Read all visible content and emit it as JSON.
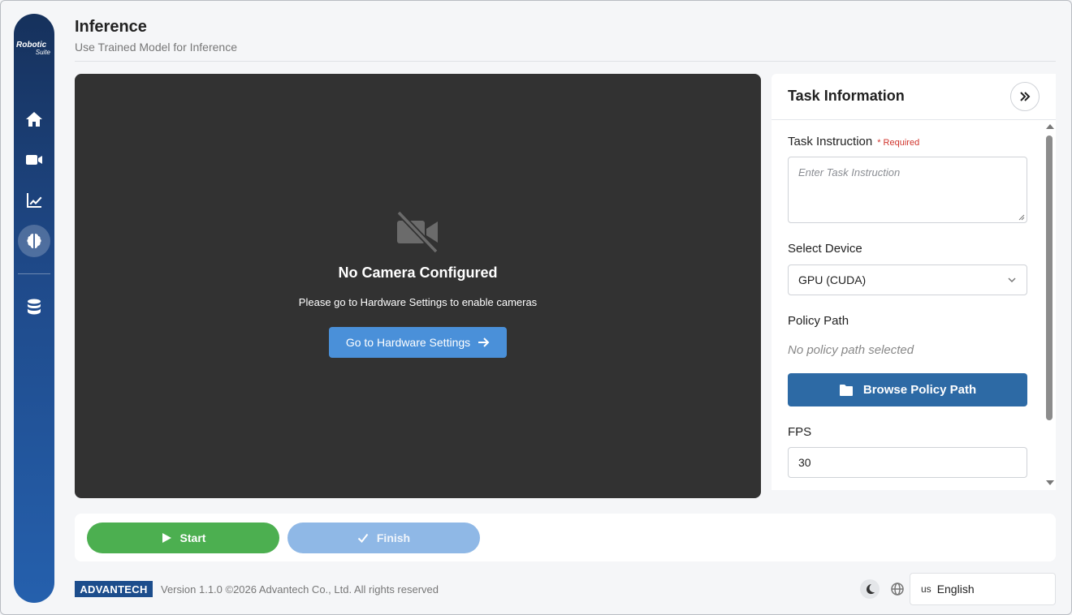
{
  "sidebar": {
    "logo_line1": "Robotic",
    "logo_line2": "Suite",
    "items": [
      {
        "icon": "home-icon"
      },
      {
        "icon": "video-camera-icon"
      },
      {
        "icon": "chart-line-icon"
      },
      {
        "icon": "brain-icon",
        "active": true
      },
      {
        "icon": "database-icon"
      }
    ]
  },
  "header": {
    "title": "Inference",
    "subtitle": "Use Trained Model for Inference"
  },
  "camera": {
    "title": "No Camera Configured",
    "message": "Please go to Hardware Settings to enable cameras",
    "button_label": "Go to Hardware Settings"
  },
  "task_panel": {
    "title": "Task Information",
    "instruction_label": "Task Instruction",
    "required_label": "* Required",
    "instruction_placeholder": "Enter Task Instruction",
    "device_label": "Select Device",
    "device_value": "GPU (CUDA)",
    "policy_label": "Policy Path",
    "policy_value": "No policy path selected",
    "browse_label": "Browse Policy Path",
    "fps_label": "FPS",
    "fps_value": "30"
  },
  "actions": {
    "start_label": "Start",
    "finish_label": "Finish"
  },
  "footer": {
    "brand": "ADVANTECH",
    "version": "Version 1.1.0 ©2026 Advantech Co., Ltd. All rights reserved",
    "language_flag": "us",
    "language": "English"
  },
  "colors": {
    "sidebar": "#1f4a8a",
    "primary_button": "#4a90d9",
    "browse_button": "#2d6aa5",
    "start": "#4caf50",
    "finish": "#8fb8e6",
    "required": "#d0342c"
  }
}
